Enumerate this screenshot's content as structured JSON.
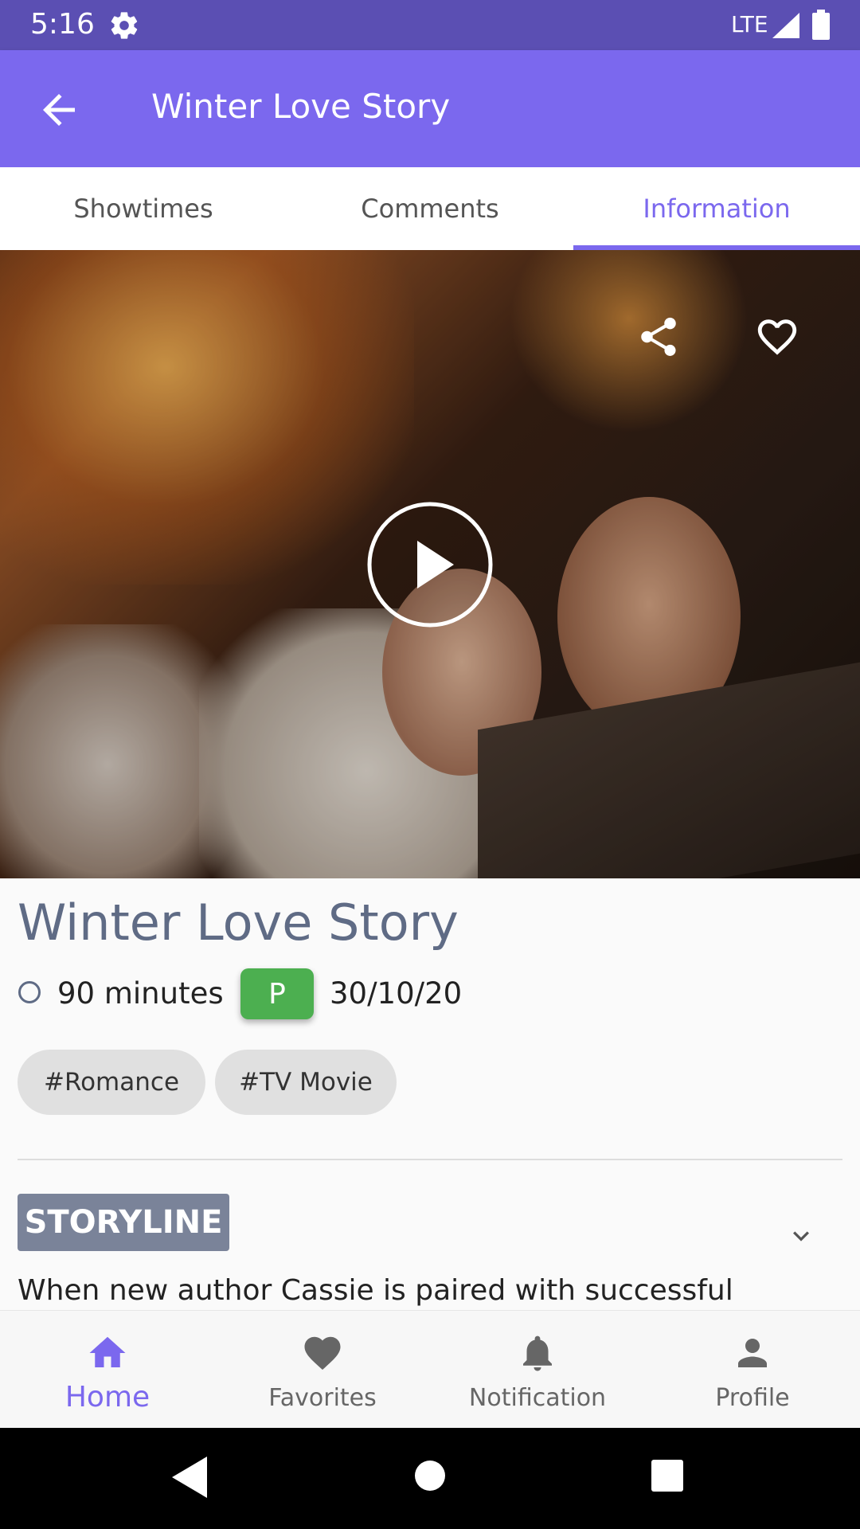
{
  "status_bar": {
    "time": "5:16",
    "network": "LTE"
  },
  "app_bar": {
    "title": "Winter Love Story"
  },
  "tabs": [
    {
      "label": "Showtimes",
      "active": false
    },
    {
      "label": "Comments",
      "active": false
    },
    {
      "label": "Information",
      "active": true
    }
  ],
  "hero": {
    "icons": [
      "share-icon",
      "heart-outline-icon",
      "play-circle-icon"
    ]
  },
  "movie": {
    "title": "Winter Love Story",
    "duration": "90 minutes",
    "rating": "P",
    "release_date": "30/10/20",
    "tags": [
      "#Romance",
      "#TV Movie"
    ]
  },
  "storyline": {
    "label": "STORYLINE",
    "text": "When new author Cassie is paired with successful"
  },
  "bottom_nav": [
    {
      "label": "Home",
      "icon": "home-icon",
      "active": true
    },
    {
      "label": "Favorites",
      "icon": "heart-icon",
      "active": false
    },
    {
      "label": "Notification",
      "icon": "bell-icon",
      "active": false
    },
    {
      "label": "Profile",
      "icon": "person-icon",
      "active": false
    }
  ],
  "colors": {
    "accent": "#7b68ee",
    "status_bar": "#5b4fb3",
    "rating_badge": "#4caf50",
    "storyline_label": "#7a8399"
  }
}
